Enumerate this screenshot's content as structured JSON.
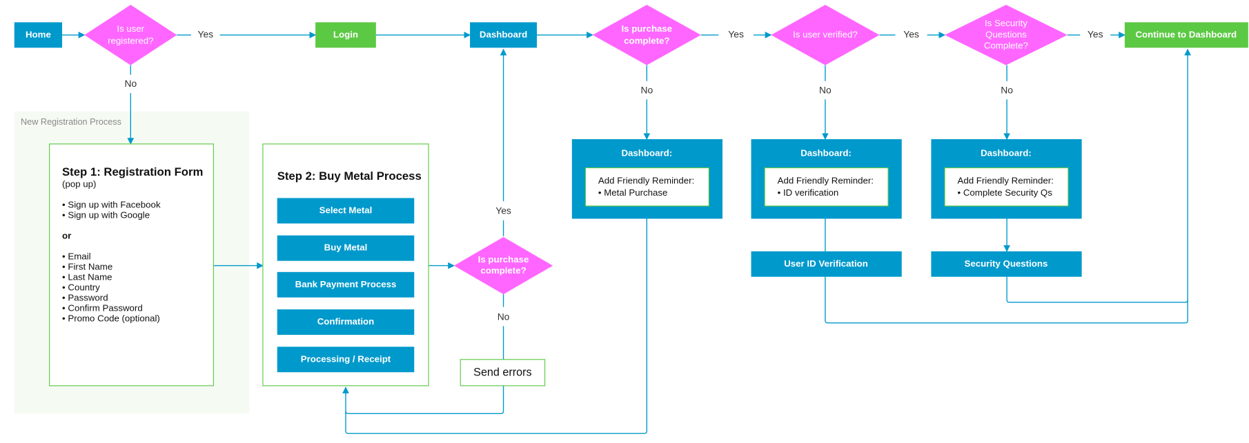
{
  "colors": {
    "process": "#0099CC",
    "terminal": "#5CC944",
    "decision": "#FF66FF",
    "connector": "#0099CC",
    "group_bg": "#F5FBF3"
  },
  "nodes": {
    "home": "Home",
    "is_registered": [
      "Is user",
      "registered?"
    ],
    "login": "Login",
    "dashboard": "Dashboard",
    "is_purchase_complete_top": [
      "Is purchase",
      "complete?"
    ],
    "is_user_verified": "Is user verified?",
    "is_security_complete": [
      "Is Security",
      "Questions",
      "Complete?"
    ],
    "continue": "Continue to Dashboard",
    "group_label": "New Registration Process",
    "step1": {
      "title": "Step 1: Registration Form",
      "subtitle": "(pop up)",
      "social": [
        "• Sign up with Facebook",
        "• Sign up with Google"
      ],
      "or": "or",
      "fields": [
        "• Email",
        "• First Name",
        "• Last Name",
        "• Country",
        "• Password",
        "• Confirm Password",
        "• Promo Code (optional)"
      ]
    },
    "step2": {
      "title": "Step 2: Buy Metal Process",
      "steps": [
        "Select Metal",
        "Buy Metal",
        "Bank Payment Process",
        "Confirmation",
        "Processing / Receipt"
      ]
    },
    "is_purchase_complete_bottom": [
      "Is purchase",
      "complete?"
    ],
    "send_errors": "Send errors",
    "reminders": [
      {
        "title": "Dashboard:",
        "line1": "Add Friendly Reminder:",
        "line2": "• Metal Purchase"
      },
      {
        "title": "Dashboard:",
        "line1": "Add Friendly Reminder:",
        "line2": "• ID verification"
      },
      {
        "title": "Dashboard:",
        "line1": "Add Friendly Reminder:",
        "line2": "• Complete Security Qs"
      }
    ],
    "user_id_verification": "User ID Verification",
    "security_questions": "Security Questions"
  },
  "edge_labels": {
    "yes": "Yes",
    "no": "No"
  }
}
